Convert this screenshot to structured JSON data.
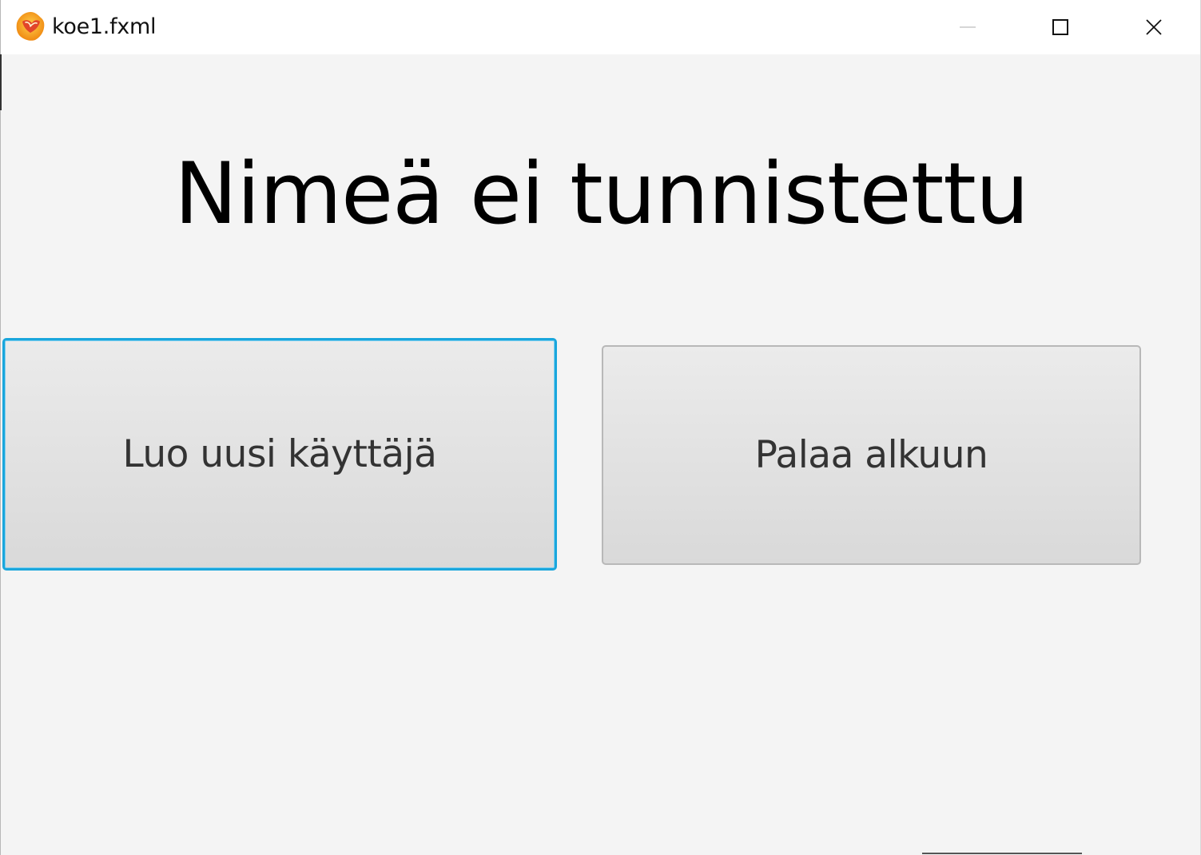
{
  "window": {
    "title": "koe1.fxml",
    "controls": {
      "minimize_icon": "minimize-icon",
      "maximize_icon": "maximize-icon",
      "close_icon": "close-icon"
    }
  },
  "main": {
    "heading": "Nimeä ei tunnistettu",
    "create_user_label": "Luo uusi käyttäjä",
    "back_to_start_label": "Palaa alkuun"
  },
  "colors": {
    "focus_border": "#1aa6dc",
    "background": "#f4f4f4",
    "app_icon_orange": "#f39a1e"
  }
}
